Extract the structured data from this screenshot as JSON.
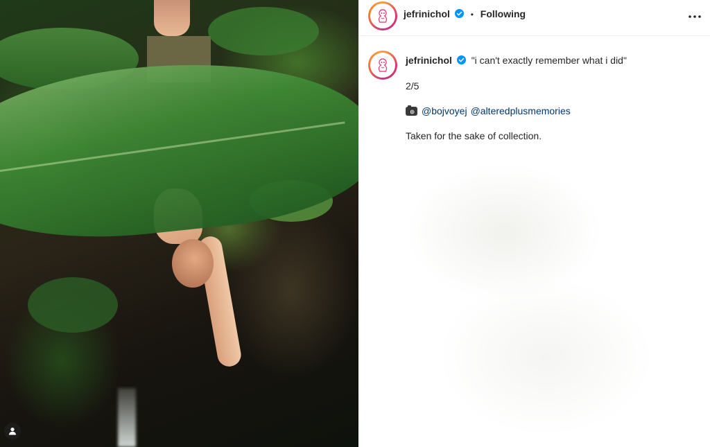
{
  "post": {
    "username": "jefrinichol",
    "header_dot": "•",
    "follow_status": "Following",
    "caption_quote": "\"i can't exactly remember what i did\"",
    "page_indicator": "2/5",
    "mentions": [
      "@bojvoyej",
      "@alteredplusmemories"
    ],
    "note": "Taken for the sake of collection."
  },
  "colors": {
    "verified": "#0095f6",
    "mention": "#00376b",
    "text": "#262626"
  },
  "icons": {
    "verified": "verified-badge-icon",
    "more": "more-options-icon",
    "camera": "camera-emoji-icon",
    "user_tag": "user-tag-icon"
  }
}
